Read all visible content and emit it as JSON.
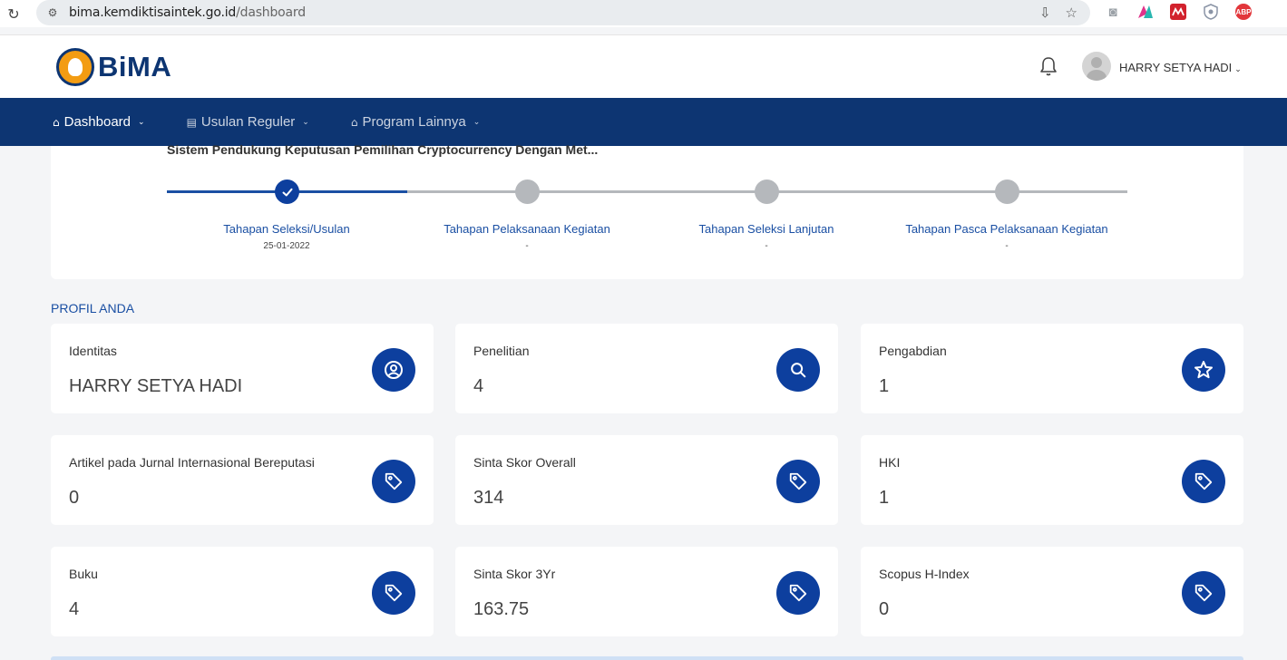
{
  "browser": {
    "url_host": "bima.kemdiktisaintek.go.id",
    "url_path": "/dashboard",
    "extensions": [
      {
        "name": "camera-ext-icon",
        "color": "#9aa0a6",
        "label": ""
      },
      {
        "name": "mozaic-ext-icon",
        "color": "#ffffff",
        "label": ""
      },
      {
        "name": "mendeley-ext-icon",
        "color": "#d2222d",
        "label": ""
      },
      {
        "name": "shield-ext-icon",
        "color": "#ffffff",
        "label": ""
      },
      {
        "name": "adblock-ext-icon",
        "color": "#e2363b",
        "label": "ABP"
      }
    ]
  },
  "header": {
    "logo_text": "BiMA",
    "user_name": "HARRY SETYA HADI"
  },
  "nav": {
    "items": [
      {
        "label": "Dashboard",
        "icon": "home-icon"
      },
      {
        "label": "Usulan Reguler",
        "icon": "document-icon"
      },
      {
        "label": "Program Lainnya",
        "icon": "home-icon"
      }
    ]
  },
  "progress": {
    "title": "Sistem Pendukung Keputusan Pemilihan Cryptocurrency Dengan Met...",
    "completed_steps": 1,
    "steps": [
      {
        "label": "Tahapan Seleksi/Usulan",
        "date": "25-01-2022"
      },
      {
        "label": "Tahapan Pelaksanaan Kegiatan",
        "date": "-"
      },
      {
        "label": "Tahapan Seleksi Lanjutan",
        "date": "-"
      },
      {
        "label": "Tahapan Pasca Pelaksanaan Kegiatan",
        "date": "-"
      }
    ]
  },
  "profile": {
    "section_title": "PROFIL ANDA",
    "cards": [
      {
        "label": "Identitas",
        "value": "HARRY SETYA HADI",
        "icon": "user-circle-icon"
      },
      {
        "label": "Penelitian",
        "value": "4",
        "icon": "search-icon"
      },
      {
        "label": "Pengabdian",
        "value": "1",
        "icon": "star-icon"
      },
      {
        "label": "Artikel pada Jurnal Internasional Bereputasi",
        "value": "0",
        "icon": "tag-icon"
      },
      {
        "label": "Sinta Skor Overall",
        "value": "314",
        "icon": "tag-icon"
      },
      {
        "label": "HKI",
        "value": "1",
        "icon": "tag-icon"
      },
      {
        "label": "Buku",
        "value": "4",
        "icon": "tag-icon"
      },
      {
        "label": "Sinta Skor 3Yr",
        "value": "163.75",
        "icon": "tag-icon"
      },
      {
        "label": "Scopus H-Index",
        "value": "0",
        "icon": "tag-icon"
      }
    ]
  },
  "colors": {
    "brand_navy": "#0d3572",
    "accent_blue": "#0d3f9e",
    "inactive_step": "#b5b8bc"
  }
}
